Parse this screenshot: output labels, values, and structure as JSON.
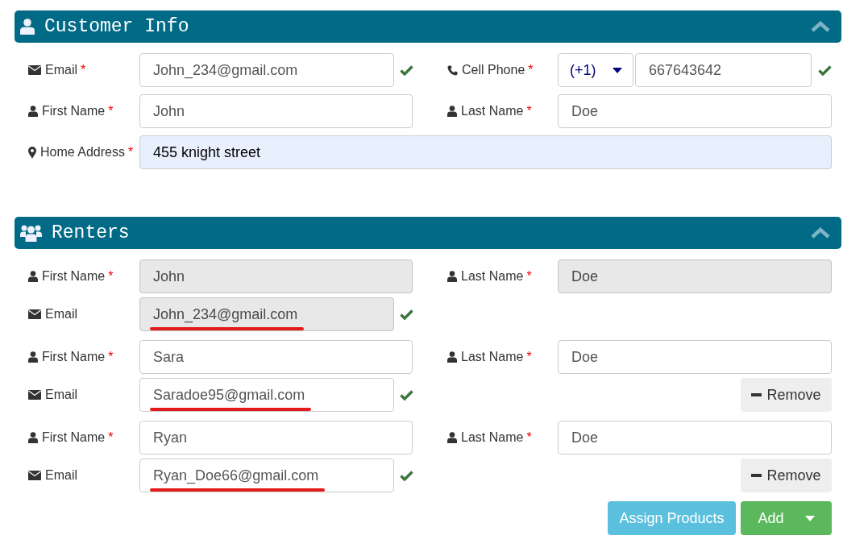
{
  "customer_info": {
    "title": "Customer Info",
    "expanded": true,
    "fields": [
      {
        "kind": "email",
        "label": "Email",
        "marker": "*",
        "value": "John_234@gmail.com",
        "valid": true,
        "autofilled": false
      },
      {
        "kind": "phone",
        "label": "Cell Phone",
        "marker": "*",
        "country_code": "(+1)",
        "value": "667643642",
        "valid": true,
        "autofilled": false
      },
      {
        "kind": "name",
        "label": "First Name",
        "marker": "*",
        "value": "John",
        "autofilled": false
      },
      {
        "kind": "name",
        "label": "Last Name",
        "marker": "*",
        "value": "Doe",
        "autofilled": false
      },
      {
        "kind": "address",
        "label": "Home Address",
        "marker": "*",
        "value": "455 knight street",
        "autofilled": true
      }
    ]
  },
  "renters": {
    "title": "Renters",
    "expanded": true,
    "entries": [
      {
        "first_name": {
          "label": "First Name",
          "marker": "*",
          "value": "John",
          "disabled": true
        },
        "last_name": {
          "label": "Last Name",
          "marker": "*",
          "value": "Doe",
          "disabled": true
        },
        "email": {
          "label": "Email",
          "value": "John_234@gmail.com",
          "disabled": true,
          "valid": true,
          "underlined": true
        }
      },
      {
        "first_name": {
          "label": "First Name",
          "marker": "*",
          "value": "Sara",
          "disabled": false
        },
        "last_name": {
          "label": "Last Name",
          "marker": "*",
          "value": "Doe",
          "disabled": false
        },
        "email": {
          "label": "Email",
          "value": "Saradoe95@gmail.com",
          "disabled": false,
          "valid": true,
          "underlined": true
        },
        "remove_button": "Remove"
      },
      {
        "first_name": {
          "label": "First Name",
          "marker": "*",
          "value": "Ryan",
          "disabled": false
        },
        "last_name": {
          "label": "Last Name",
          "marker": "*",
          "value": "Doe",
          "disabled": false
        },
        "email": {
          "label": "Email",
          "value": "Ryan_Doe66@gmail.com",
          "disabled": false,
          "valid": true,
          "underlined": true
        },
        "remove_button": "Remove"
      }
    ],
    "actions": [
      {
        "kind": "info",
        "label": "Assign Products"
      },
      {
        "kind": "success",
        "label": "Add",
        "dropdown": true
      }
    ]
  }
}
